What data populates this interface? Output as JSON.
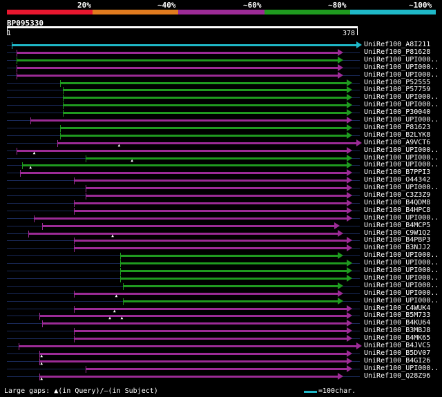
{
  "bands": {
    "labels": [
      "20%",
      "~40%",
      "~60%",
      "~80%",
      "~100%"
    ],
    "colors": [
      "#e8172f",
      "#e07b1f",
      "#9c2b96",
      "#1f9a1f",
      "#1fb8c8"
    ]
  },
  "query": {
    "name": "BP095330",
    "start": "1",
    "end": "378"
  },
  "scale": {
    "length": 378
  },
  "rows": [
    {
      "name": "UniRef100_A8I211",
      "color": "#1fb8c8",
      "from": 5,
      "to": 378,
      "tri": []
    },
    {
      "name": "UniRef100_P81628",
      "color": "#9c2b96",
      "from": 10,
      "to": 358,
      "tri": []
    },
    {
      "name": "UniRef100_UPI000..",
      "color": "#1f9a1f",
      "from": 10,
      "to": 358,
      "tri": []
    },
    {
      "name": "UniRef100_UPI000..",
      "color": "#9c2b96",
      "from": 10,
      "to": 358,
      "tri": []
    },
    {
      "name": "UniRef100_UPI000..",
      "color": "#9c2b96",
      "from": 10,
      "to": 358,
      "tri": []
    },
    {
      "name": "UniRef100_P52555",
      "color": "#1f9a1f",
      "from": 57,
      "to": 368,
      "tri": []
    },
    {
      "name": "UniRef100_P57759",
      "color": "#1f9a1f",
      "from": 60,
      "to": 368,
      "tri": []
    },
    {
      "name": "UniRef100_UPI000..",
      "color": "#1f9a1f",
      "from": 60,
      "to": 368,
      "tri": []
    },
    {
      "name": "UniRef100_UPI000..",
      "color": "#1f9a1f",
      "from": 60,
      "to": 368,
      "tri": []
    },
    {
      "name": "UniRef100_P30040",
      "color": "#1f9a1f",
      "from": 60,
      "to": 368,
      "tri": []
    },
    {
      "name": "UniRef100_UPI000..",
      "color": "#9c2b96",
      "from": 25,
      "to": 368,
      "tri": []
    },
    {
      "name": "UniRef100_P81623",
      "color": "#1f9a1f",
      "from": 57,
      "to": 368,
      "tri": []
    },
    {
      "name": "UniRef100_B2LYK8",
      "color": "#1f9a1f",
      "from": 57,
      "to": 368,
      "tri": []
    },
    {
      "name": "UniRef100_A9VCT6",
      "color": "#9c2b96",
      "from": 54,
      "to": 378,
      "tri": [
        122
      ]
    },
    {
      "name": "UniRef100_UPI000..",
      "color": "#9c2b96",
      "from": 10,
      "to": 368,
      "tri": [
        30
      ]
    },
    {
      "name": "UniRef100_UPI000..",
      "color": "#1f9a1f",
      "from": 85,
      "to": 368,
      "tri": [
        136
      ]
    },
    {
      "name": "UniRef100_UPI000..",
      "color": "#1f9a1f",
      "from": 16,
      "to": 368,
      "tri": [
        26
      ]
    },
    {
      "name": "UniRef100_B7PPI3",
      "color": "#9c2b96",
      "from": 14,
      "to": 368,
      "tri": []
    },
    {
      "name": "UniRef100_O44342",
      "color": "#9c2b96",
      "from": 72,
      "to": 368,
      "tri": []
    },
    {
      "name": "UniRef100_UPI000..",
      "color": "#9c2b96",
      "from": 85,
      "to": 368,
      "tri": []
    },
    {
      "name": "UniRef100_C3Z3Z9",
      "color": "#9c2b96",
      "from": 85,
      "to": 368,
      "tri": []
    },
    {
      "name": "UniRef100_B4QDM8",
      "color": "#9c2b96",
      "from": 72,
      "to": 368,
      "tri": []
    },
    {
      "name": "UniRef100_B4HPC8",
      "color": "#9c2b96",
      "from": 72,
      "to": 368,
      "tri": []
    },
    {
      "name": "UniRef100_UPI000..",
      "color": "#9c2b96",
      "from": 29,
      "to": 368,
      "tri": []
    },
    {
      "name": "UniRef100_B4MCP5",
      "color": "#9c2b96",
      "from": 38,
      "to": 354,
      "tri": []
    },
    {
      "name": "UniRef100_C9W1Q2",
      "color": "#9c2b96",
      "from": 23,
      "to": 358,
      "tri": [
        115
      ]
    },
    {
      "name": "UniRef100_B4PBP3",
      "color": "#9c2b96",
      "from": 72,
      "to": 368,
      "tri": []
    },
    {
      "name": "UniRef100_B3NJJ2",
      "color": "#9c2b96",
      "from": 72,
      "to": 368,
      "tri": []
    },
    {
      "name": "UniRef100_UPI000..",
      "color": "#1f9a1f",
      "from": 122,
      "to": 358,
      "tri": []
    },
    {
      "name": "UniRef100_UPI000..",
      "color": "#1f9a1f",
      "from": 122,
      "to": 368,
      "tri": []
    },
    {
      "name": "UniRef100_UPI000..",
      "color": "#1f9a1f",
      "from": 122,
      "to": 368,
      "tri": []
    },
    {
      "name": "UniRef100_UPI000..",
      "color": "#1f9a1f",
      "from": 122,
      "to": 368,
      "tri": []
    },
    {
      "name": "UniRef100_UPI000..",
      "color": "#1f9a1f",
      "from": 125,
      "to": 358,
      "tri": []
    },
    {
      "name": "UniRef100_UPI000..",
      "color": "#9c2b96",
      "from": 72,
      "to": 358,
      "tri": [
        119
      ]
    },
    {
      "name": "UniRef100_UPI000..",
      "color": "#1f9a1f",
      "from": 125,
      "to": 358,
      "tri": []
    },
    {
      "name": "UniRef100_C4WUK4",
      "color": "#9c2b96",
      "from": 72,
      "to": 368,
      "tri": [
        117
      ]
    },
    {
      "name": "UniRef100_B5M733",
      "color": "#9c2b96",
      "from": 35,
      "to": 368,
      "tri": [
        112,
        125
      ]
    },
    {
      "name": "UniRef100_B4KU64",
      "color": "#9c2b96",
      "from": 38,
      "to": 368,
      "tri": []
    },
    {
      "name": "UniRef100_B3MBJ8",
      "color": "#9c2b96",
      "from": 72,
      "to": 368,
      "tri": []
    },
    {
      "name": "UniRef100_B4MK65",
      "color": "#9c2b96",
      "from": 72,
      "to": 368,
      "tri": []
    },
    {
      "name": "UniRef100_B4JVC5",
      "color": "#9c2b96",
      "from": 12,
      "to": 378,
      "tri": []
    },
    {
      "name": "UniRef100_B5DV07",
      "color": "#9c2b96",
      "from": 35,
      "to": 368,
      "tri": [
        38
      ]
    },
    {
      "name": "UniRef100_B4GI26",
      "color": "#9c2b96",
      "from": 35,
      "to": 368,
      "tri": [
        38
      ]
    },
    {
      "name": "UniRef100_UPI000..",
      "color": "#9c2b96",
      "from": 85,
      "to": 368,
      "tri": []
    },
    {
      "name": "UniRef100_Q28Z96",
      "color": "#9c2b96",
      "from": 35,
      "to": 358,
      "tri": [
        38
      ]
    }
  ],
  "legend": {
    "text": "Large gaps:",
    "query_part": "▲(in Query)/",
    "subject_part": "–(in Subject)",
    "scale_label": "=100char."
  }
}
